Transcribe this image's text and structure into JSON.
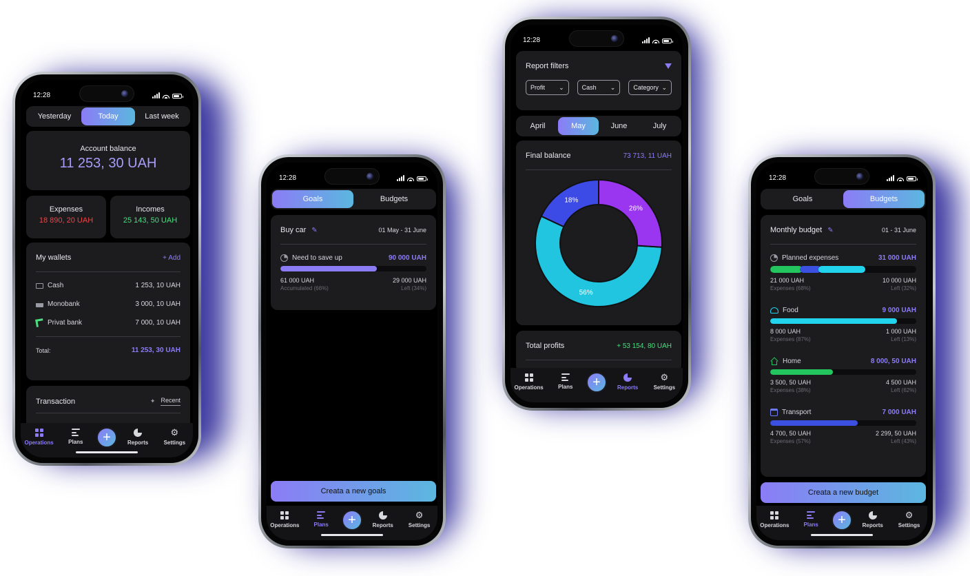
{
  "status_time": "12:28",
  "colors": {
    "accent": "#8b7cf6",
    "accent2": "#5bb7df",
    "income": "#4ade80",
    "expense": "#ef4444",
    "cyan": "#22d3ee",
    "blue": "#3b4fe0",
    "violet": "#9333ea",
    "green": "#22c55e"
  },
  "nav": {
    "operations": "Operations",
    "plans": "Plans",
    "reports": "Reports",
    "settings": "Settings",
    "add": "+"
  },
  "phone1": {
    "periods": [
      "Yesterday",
      "Today",
      "Last week"
    ],
    "balance_label": "Account balance",
    "balance_value": "11 253, 30 UAH",
    "expenses_label": "Expenses",
    "expenses_value": "18 890, 20 UAH",
    "incomes_label": "Incomes",
    "incomes_value": "25 143, 50 UAH",
    "wallets_title": "My wallets",
    "add_label": "+ Add",
    "wallets": [
      {
        "name": "Cash",
        "amount": "1 253, 10 UAH",
        "icon": "cash-icon"
      },
      {
        "name": "Monobank",
        "amount": "3 000, 10 UAH",
        "icon": "card-icon"
      },
      {
        "name": "Privat bank",
        "amount": "7 000, 10 UAH",
        "icon": "privat-icon"
      }
    ],
    "total_label": "Total:",
    "total_value": "11 253, 30 UAH",
    "transaction_title": "Transaction",
    "recent_label": "Recent"
  },
  "phone2": {
    "tabs": [
      "Goals",
      "Budgets"
    ],
    "goal_title": "Buy car",
    "goal_dates": "01 May - 31 June",
    "need_label": "Need to save up",
    "need_value": "90 000 UAH",
    "progress": 0.66,
    "accumulated_value": "61 000 UAH",
    "accumulated_label": "Accumulated (66%)",
    "left_value": "29 000 UAH",
    "left_label": "Left (34%)",
    "cta": "Creata a new goals"
  },
  "phone3": {
    "filters_title": "Report filters",
    "filters": [
      "Profit",
      "Cash",
      "Category"
    ],
    "months": [
      "April",
      "May",
      "June",
      "July"
    ],
    "final_label": "Final balance",
    "final_value": "73 713, 11 UAH",
    "chart_data": {
      "type": "pie",
      "categories": [
        "",
        "",
        ""
      ],
      "values": [
        56,
        18,
        26
      ],
      "labels": [
        "56%",
        "18%",
        "26%"
      ],
      "colors": [
        "#22c5e0",
        "#3d4be6",
        "#9a35f0"
      ]
    },
    "profits_label": "Total profits",
    "profits_value": "+ 53 154, 80 UAH"
  },
  "phone4": {
    "tabs": [
      "Goals",
      "Budgets"
    ],
    "budget_title": "Monthly budget",
    "budget_dates": "01 - 31 June",
    "planned": {
      "label": "Planned expenses",
      "value": "31 000 UAH",
      "segments": [
        0.22,
        0.15,
        0.32
      ],
      "spent_value": "21 000 UAH",
      "spent_label": "Expenses (68%)",
      "left_value": "10 000 UAH",
      "left_label": "Left (32%)"
    },
    "categories": [
      {
        "label": "Food",
        "value": "9 000 UAH",
        "progress": 0.87,
        "spent_value": "8 000 UAH",
        "spent_label": "Expenses (87%)",
        "left_value": "1 000 UAH",
        "left_label": "Left (13%)"
      },
      {
        "label": "Home",
        "value": "8 000, 50 UAH",
        "progress": 0.43,
        "spent_value": "3 500, 50 UAH",
        "spent_label": "Expenses (38%)",
        "left_value": "4 500 UAH",
        "left_label": "Left (62%)"
      },
      {
        "label": "Transport",
        "value": "7 000 UAH",
        "progress": 0.6,
        "spent_value": "4 700, 50 UAH",
        "spent_label": "Expenses (57%)",
        "left_value": "2 299, 50 UAH",
        "left_label": "Left (43%)"
      }
    ],
    "cta": "Creata a new budget"
  }
}
